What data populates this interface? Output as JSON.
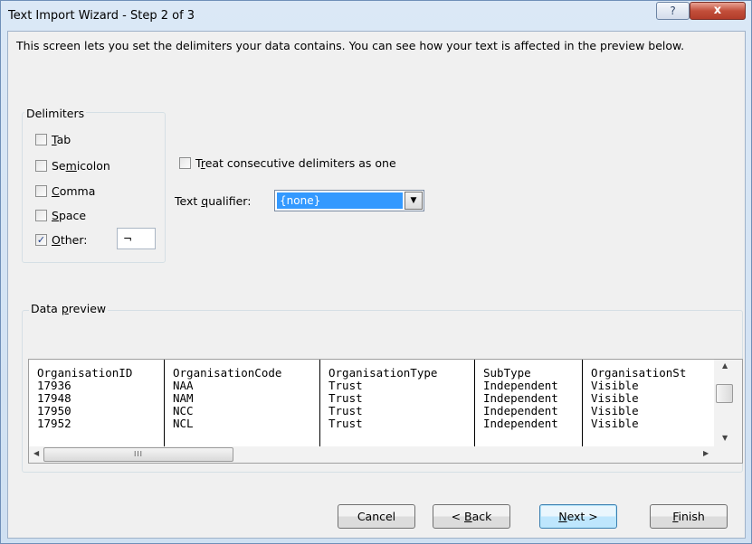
{
  "window": {
    "title": "Text Import Wizard - Step 2 of 3",
    "help_label": "?",
    "close_label": "x"
  },
  "description": "This screen lets you set the delimiters your data contains.  You can see how your text is affected in the preview below.",
  "delimiters": {
    "group_label": "Delimiters",
    "tab": {
      "label_pre": "",
      "key": "T",
      "label_post": "ab",
      "checked": false
    },
    "semicolon": {
      "label_pre": "Se",
      "key": "m",
      "label_post": "icolon",
      "checked": false
    },
    "comma": {
      "label_pre": "",
      "key": "C",
      "label_post": "omma",
      "checked": false
    },
    "space": {
      "label_pre": "",
      "key": "S",
      "label_post": "pace",
      "checked": false
    },
    "other": {
      "label_pre": "",
      "key": "O",
      "label_post": "ther:",
      "checked": true,
      "value": "¬"
    }
  },
  "consecutive": {
    "label_pre": "T",
    "key": "r",
    "label_post": "eat consecutive delimiters as one",
    "checked": false
  },
  "qualifier": {
    "label_pre": "Text ",
    "key": "q",
    "label_post": "ualifier:",
    "value": "{none}"
  },
  "preview": {
    "group_label_pre": "Data ",
    "group_label_key": "p",
    "group_label_post": "review",
    "columns": [
      {
        "header": "OrganisationID",
        "values": [
          "17936",
          "17948",
          "17950",
          "17952"
        ]
      },
      {
        "header": "OrganisationCode",
        "values": [
          "NAA",
          "NAM",
          "NCC",
          "NCL"
        ]
      },
      {
        "header": "OrganisationType",
        "values": [
          "Trust",
          "Trust",
          "Trust",
          "Trust"
        ]
      },
      {
        "header": "SubType",
        "values": [
          "Independent",
          "Independent",
          "Independent",
          "Independent"
        ]
      },
      {
        "header": "OrganisationSt",
        "values": [
          "Visible",
          "Visible",
          "Visible",
          "Visible"
        ]
      }
    ],
    "thumb_grip": "III"
  },
  "buttons": {
    "cancel": "Cancel",
    "back": {
      "pre": "< ",
      "key": "B",
      "post": "ack"
    },
    "next": {
      "pre": "",
      "key": "N",
      "post": "ext >"
    },
    "finish": {
      "pre": "",
      "key": "F",
      "post": "inish"
    }
  },
  "icons": {
    "check": "✓",
    "dropdown": "▼",
    "up": "▲",
    "down": "▼",
    "left": "◀",
    "right": "▶"
  }
}
